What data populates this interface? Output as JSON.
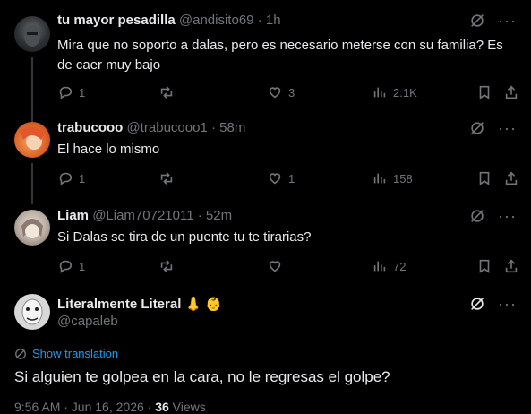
{
  "replies": [
    {
      "name": "tu mayor pesadilla",
      "handle": "@andisito69",
      "time": "1h",
      "text": "Mira que no soporto a dalas, pero es necesario meterse con su familia? Es de caer muy bajo",
      "replies": "1",
      "reposts": "",
      "likes": "3",
      "views": "2.1K"
    },
    {
      "name": "trabucooo",
      "handle": "@trabucooo1",
      "time": "58m",
      "text": "El hace lo mismo",
      "replies": "1",
      "reposts": "",
      "likes": "1",
      "views": "158"
    },
    {
      "name": "Liam",
      "handle": "@Liam70721011",
      "time": "52m",
      "text": "Si Dalas se tira de un puente tu te tirarias?",
      "replies": "1",
      "reposts": "",
      "likes": "",
      "views": "72"
    }
  ],
  "main": {
    "name": "Literalmente Literal",
    "emoji": "👃 👶",
    "handle": "@capaleb",
    "translation_link": "Show translation",
    "text": "Si alguien te golpea en la cara, no le regresas el golpe?",
    "timestamp": "9:56 AM · Jun 16, 2026 · ",
    "views_count": "36",
    "views_label": " Views"
  },
  "dot": "·",
  "colors": {
    "background": "#000000",
    "text": "#e7e9ea",
    "muted": "#71767b",
    "link": "#1d9bf0"
  }
}
